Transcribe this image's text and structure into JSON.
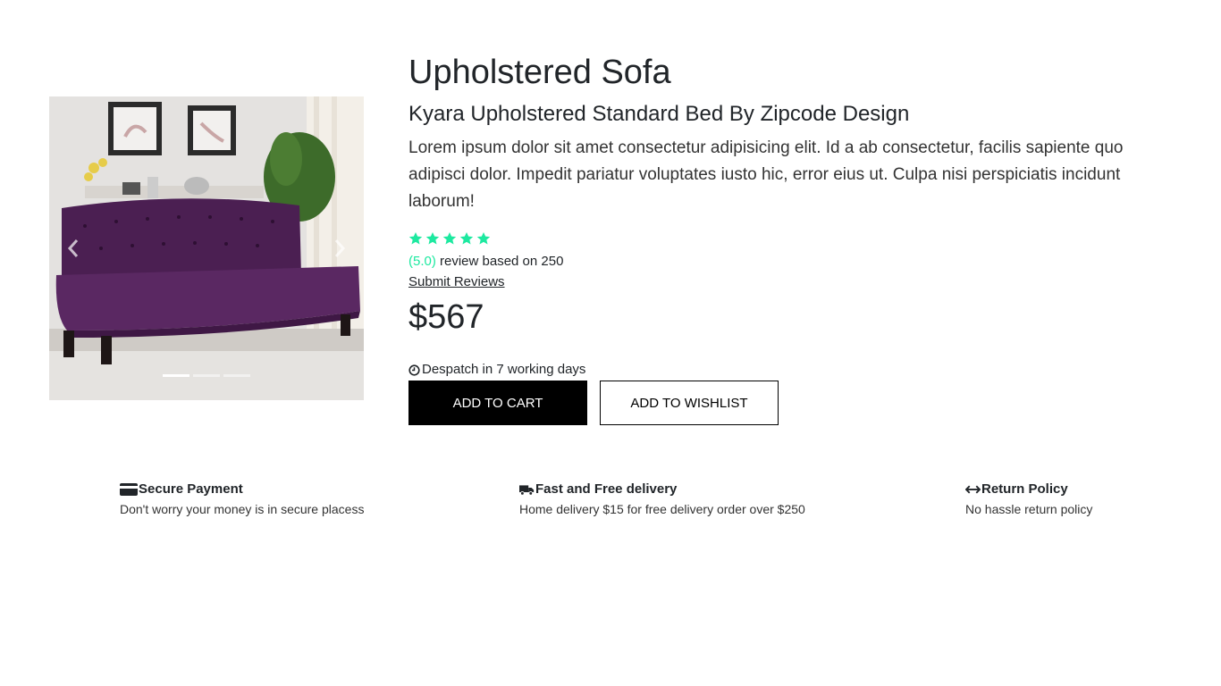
{
  "carousel": {
    "image_alt": "Purple tufted velvet sofa in a living room",
    "slide_count": 3,
    "active_slide": 1
  },
  "product": {
    "title": "Upholstered Sofa",
    "subtitle": "Kyara Upholstered Standard Bed By Zipcode Design",
    "description": "Lorem ipsum dolor sit amet consectetur adipisicing elit. Id a ab consectetur, facilis sapiente quo adipisci dolor. Impedit pariatur voluptates iusto hic, error eius ut. Culpa nisi perspiciatis incidunt laborum!",
    "rating_stars": 5,
    "rating_score": "(5.0)",
    "review_text": " review based on 250",
    "submit_reviews_label": "Submit Reviews",
    "price": "$567",
    "despatch": "Despatch in 7 working days",
    "add_to_cart_label": "ADD TO CART",
    "add_to_wishlist_label": "ADD TO WISHLIST"
  },
  "features": [
    {
      "icon": "credit-card-icon",
      "title": "Secure Payment",
      "text": "Don't worry your money is in secure placess"
    },
    {
      "icon": "truck-icon",
      "title": "Fast and Free delivery",
      "text": "Home delivery $15 for free delivery order over $250"
    },
    {
      "icon": "left-right-arrow-icon",
      "title": "Return Policy",
      "text": "No hassle return policy"
    }
  ],
  "colors": {
    "star": "#1de9a0",
    "primary_button": "#000000",
    "text": "#212529"
  }
}
